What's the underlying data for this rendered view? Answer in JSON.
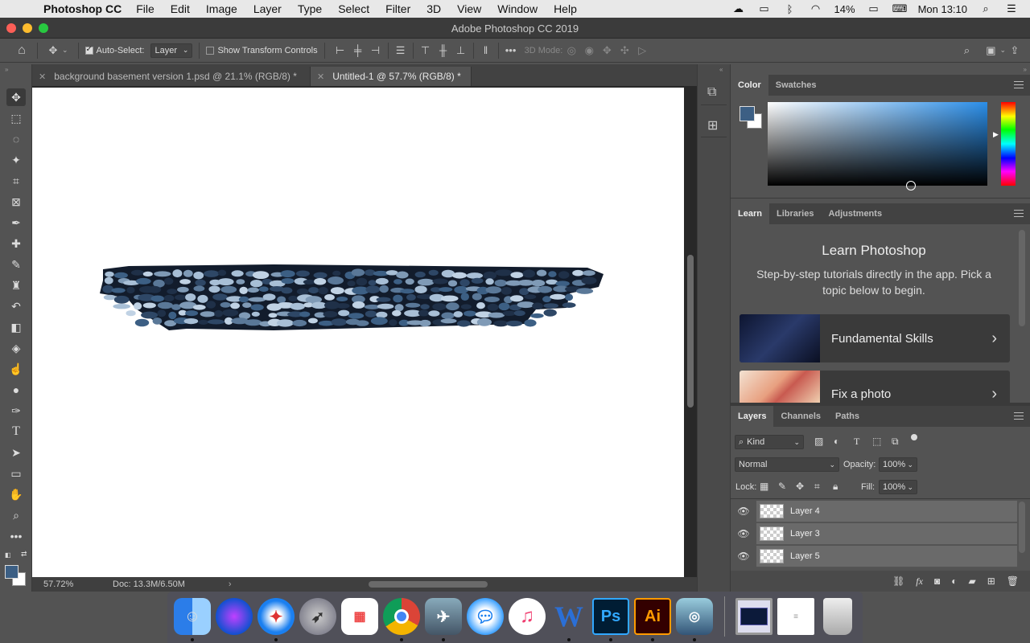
{
  "menubar": {
    "app_name": "Photoshop CC",
    "items": [
      "File",
      "Edit",
      "Image",
      "Layer",
      "Type",
      "Select",
      "Filter",
      "3D",
      "View",
      "Window",
      "Help"
    ],
    "battery": "14%",
    "clock": "Mon 13:10"
  },
  "window": {
    "title": "Adobe Photoshop CC 2019"
  },
  "options_bar": {
    "auto_select_label": "Auto-Select:",
    "auto_select_checked": true,
    "auto_select_target": "Layer",
    "show_transform_label": "Show Transform Controls",
    "show_transform_checked": false,
    "mode_3d_label": "3D Mode:"
  },
  "tabs": [
    {
      "label": "background basement version 1.psd @ 21.1% (RGB/8) *",
      "active": false
    },
    {
      "label": "Untitled-1 @ 57.7% (RGB/8) *",
      "active": true
    }
  ],
  "statusbar": {
    "zoom": "57.72%",
    "doc": "Doc: 13.3M/6.50M"
  },
  "colors": {
    "foreground": "#3c5f84",
    "background": "#ffffff"
  },
  "color_panel": {
    "tabs": [
      "Color",
      "Swatches"
    ]
  },
  "learn_panel": {
    "tabs": [
      "Learn",
      "Libraries",
      "Adjustments"
    ],
    "title": "Learn Photoshop",
    "subtitle": "Step-by-step tutorials directly in the app. Pick a topic below to begin.",
    "cards": [
      "Fundamental Skills",
      "Fix a photo"
    ]
  },
  "layers_panel": {
    "tabs": [
      "Layers",
      "Channels",
      "Paths"
    ],
    "filter_kind": "Kind",
    "blend_mode": "Normal",
    "opacity_label": "Opacity:",
    "opacity": "100%",
    "lock_label": "Lock:",
    "fill_label": "Fill:",
    "fill": "100%",
    "layers": [
      "Layer 4",
      "Layer 3",
      "Layer 5"
    ]
  },
  "dock": {
    "apps": [
      "Finder",
      "Siri",
      "Safari",
      "Launchpad",
      "Google Photos",
      "Chrome",
      "Preview",
      "Messages",
      "iTunes",
      "Word",
      "Ps",
      "Ai",
      "Image Capture",
      "Screenshot",
      "Document",
      "Trash"
    ]
  }
}
